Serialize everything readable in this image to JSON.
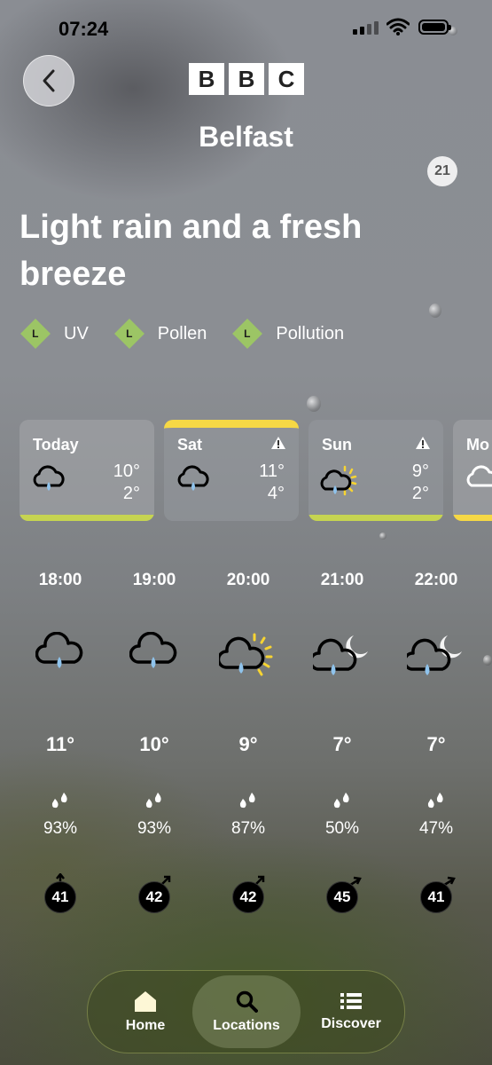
{
  "status_bar": {
    "time": "07:24"
  },
  "header": {
    "brand": [
      "B",
      "B",
      "C"
    ],
    "location": "Belfast",
    "badge": "21"
  },
  "summary": {
    "headline": "Light rain and a fresh breeze"
  },
  "levels": [
    {
      "level": "L",
      "label": "UV",
      "color": "#9cc565"
    },
    {
      "level": "L",
      "label": "Pollen",
      "color": "#9cc565"
    },
    {
      "level": "L",
      "label": "Pollution",
      "color": "#9cc565"
    }
  ],
  "daily": [
    {
      "day": "Today",
      "icon": "light-rain-cloud-icon",
      "high": "10°",
      "low": "2°",
      "warning": false
    },
    {
      "day": "Sat",
      "icon": "light-rain-cloud-icon",
      "high": "11°",
      "low": "4°",
      "warning": true
    },
    {
      "day": "Sun",
      "icon": "sunny-intervals-light-rain-icon",
      "high": "9°",
      "low": "2°",
      "warning": true
    },
    {
      "day": "Mo",
      "icon": "cloud-icon"
    }
  ],
  "hourly": [
    {
      "time": "18:00",
      "icon": "light-rain-cloud-icon",
      "temp": "11°",
      "rain_chance": "93%",
      "wind": "41"
    },
    {
      "time": "19:00",
      "icon": "light-rain-cloud-icon",
      "temp": "10°",
      "rain_chance": "93%",
      "wind": "42"
    },
    {
      "time": "20:00",
      "icon": "sunny-intervals-light-rain-icon",
      "temp": "9°",
      "rain_chance": "87%",
      "wind": "42"
    },
    {
      "time": "21:00",
      "icon": "night-light-rain-icon",
      "temp": "7°",
      "rain_chance": "50%",
      "wind": "45"
    },
    {
      "time": "22:00",
      "icon": "night-light-rain-icon",
      "temp": "7°",
      "rain_chance": "47%",
      "wind": "41"
    }
  ],
  "nav": {
    "home": "Home",
    "locations": "Locations",
    "discover": "Discover",
    "active": "locations"
  },
  "colors": {
    "warning_bar": "#f6d845",
    "low_level_bar": "#c6d451",
    "rain_drop": "#8fc3ec",
    "sun": "#f7d432"
  }
}
